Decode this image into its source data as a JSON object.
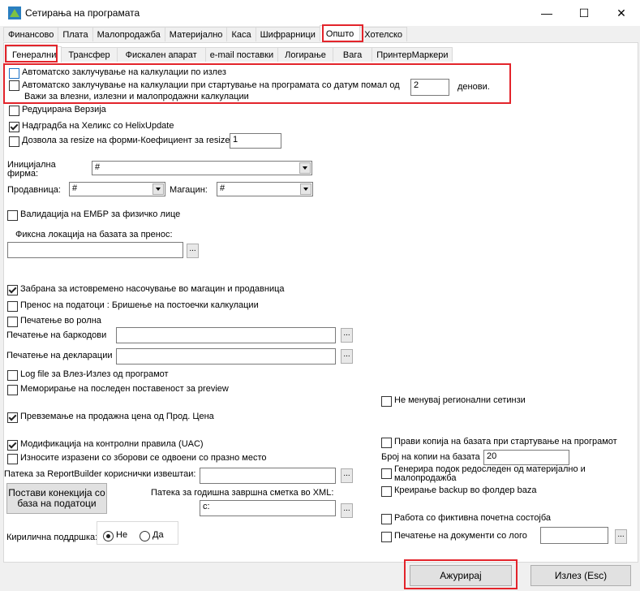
{
  "window": {
    "title": "Сетирања на програмата",
    "minimize": "—",
    "maximize": "☐",
    "close": "✕"
  },
  "main_tabs": [
    "Финансово",
    "Плата",
    "Малопродажба",
    "Материјално",
    "Каса",
    "Шифрарници",
    "Општо",
    "Хотелско"
  ],
  "sub_tabs": [
    "Генерални",
    "Трансфер",
    "Фискален апарат",
    "e-mail поставки",
    "Логирање",
    "Вага",
    "ПринтерМаркери"
  ],
  "general": {
    "auto_close_label": "Автоматско заклучување на калкулации по излез",
    "auto_close_startup_label": "Автоматско заклучување на калкулации при стартување на програмата со датум помал од",
    "auto_close_days_value": "2",
    "days_label": "денови.",
    "applies_note": "Важи за влезни, излезни и малопродажни калкулации",
    "reduced_version_label": "Редуцирана Верзија",
    "helix_update_label": "Надградба на Хеликс со HelixUpdate",
    "resize_label": "Дозвола за resize на форми-Коефициент за resize",
    "resize_value": "1",
    "initial_company_label": "Иницијална фирма:",
    "initial_company_value": "#",
    "seller_label": "Продавница:",
    "seller_value": "#",
    "warehouse_label": "Магацин:",
    "warehouse_value": "#",
    "embr_label": "Валидација на ЕМБР за физичко лице",
    "fixed_location_label": "Фиксна локација на базата за пренос:",
    "fixed_location_value": "",
    "ban_simultaneous_label": "Забрана за истовремено насочување во магацин и продавница",
    "transfer_delete_label": "Пренос на податоци : Бришење на постоечки калкулации",
    "roll_print_label": "Печатење во ролна",
    "barcode_print_label": "Печатење на баркодови",
    "barcode_print_value": "",
    "declaration_print_label": "Печатење на декларации",
    "declaration_print_value": "",
    "log_file_label": "Log file за Влез-Излез од програмот",
    "memorize_preview_label": "Меморирање на последен поставеност за preview",
    "no_regional_label": "Не менувај регионални сетинзи",
    "take_sale_price_label": "Превземање на продажна цена од Прод. Цена",
    "uac_label": "Модификација на контролни правила (UAC)",
    "amounts_separated_label": "Износите изразени со зборови се одвоени со празно место",
    "copy_db_startup_label": "Прави копија на базата при стартување на програмот",
    "db_copies_label": "Број на копии на базата",
    "db_copies_value": "20",
    "generate_order_label": "Генерира подок редоследен од материјално и малопродажба",
    "backup_folder_label": "Креирање backup во фолдер baza",
    "report_builder_label": "Патека за ReportBuilder кориснички извештаи:",
    "report_builder_value": "",
    "connection_button": "Постави конекција со база на податоци",
    "year_end_path_label": "Патека за годишна завршна сметка во XML:",
    "year_end_path_value": "c:",
    "fictive_state_label": "Работа со фиктивна почетна состојба",
    "print_logo_label": "Печатење на документи со лого",
    "print_logo_value": "",
    "cyrillic_label": "Кирилична поддршка:",
    "cyrillic_no": "Не",
    "cyrillic_yes": "Да",
    "dots": "..."
  },
  "footer": {
    "update_button": "Ажурирај",
    "exit_button": "Излез (Esc)"
  },
  "colors": {
    "highlight": "#e3242b"
  }
}
